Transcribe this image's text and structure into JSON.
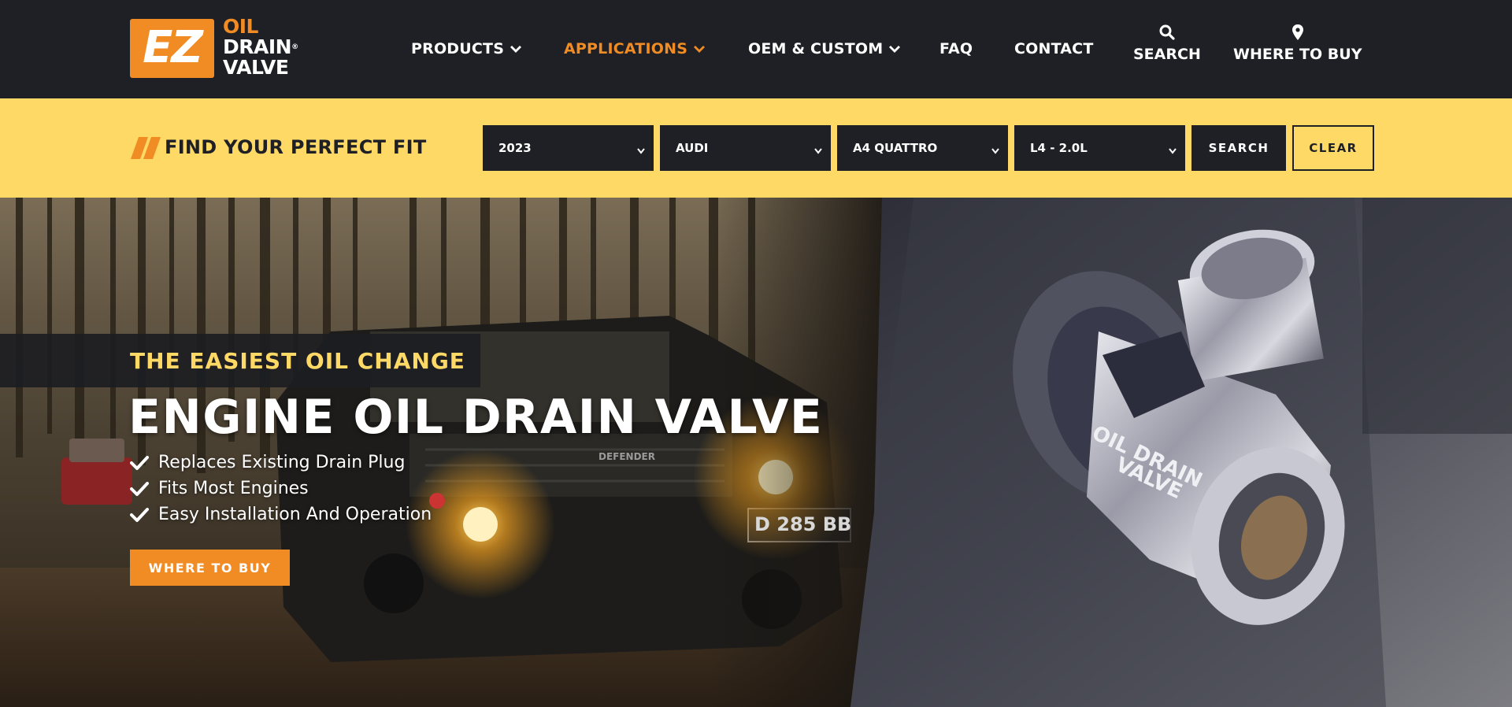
{
  "logo": {
    "mark": "EZ",
    "line1": "OIL",
    "line2": "DRAIN",
    "line3": "VALVE",
    "registered": "®"
  },
  "nav": {
    "items": [
      {
        "label": "PRODUCTS",
        "has_dropdown": true,
        "active": false
      },
      {
        "label": "APPLICATIONS",
        "has_dropdown": true,
        "active": true
      },
      {
        "label": "OEM & CUSTOM",
        "has_dropdown": true,
        "active": false
      },
      {
        "label": "FAQ",
        "has_dropdown": false,
        "active": false
      },
      {
        "label": "CONTACT",
        "has_dropdown": false,
        "active": false
      }
    ],
    "search_label": "SEARCH",
    "search_icon": "search-icon",
    "where_label": "WHERE TO BUY",
    "where_icon": "map-pin-icon"
  },
  "fit_bar": {
    "title": "FIND YOUR PERFECT FIT",
    "selects": [
      {
        "name": "year",
        "value": "2023"
      },
      {
        "name": "make",
        "value": "AUDI"
      },
      {
        "name": "model",
        "value": "A4 QUATTRO"
      },
      {
        "name": "engine",
        "value": "L4 - 2.0L"
      }
    ],
    "search_button": "SEARCH",
    "clear_button": "CLEAR"
  },
  "hero": {
    "tagline": "THE EASIEST OIL CHANGE",
    "headline": "ENGINE OIL DRAIN VALVE",
    "features": [
      "Replaces Existing Drain Plug",
      "Fits Most Engines",
      "Easy Installation And Operation"
    ],
    "cta": "WHERE TO BUY",
    "valve_engraving_1": "OIL DRAIN",
    "valve_engraving_2": "VALVE",
    "plate_text": "D 285 BB",
    "grille_text": "DEFENDER"
  },
  "colors": {
    "header_bg": "#1f2025",
    "accent_orange": "#f08c23",
    "fit_bar_yellow": "#fed966",
    "tagline_yellow": "#fed966"
  }
}
